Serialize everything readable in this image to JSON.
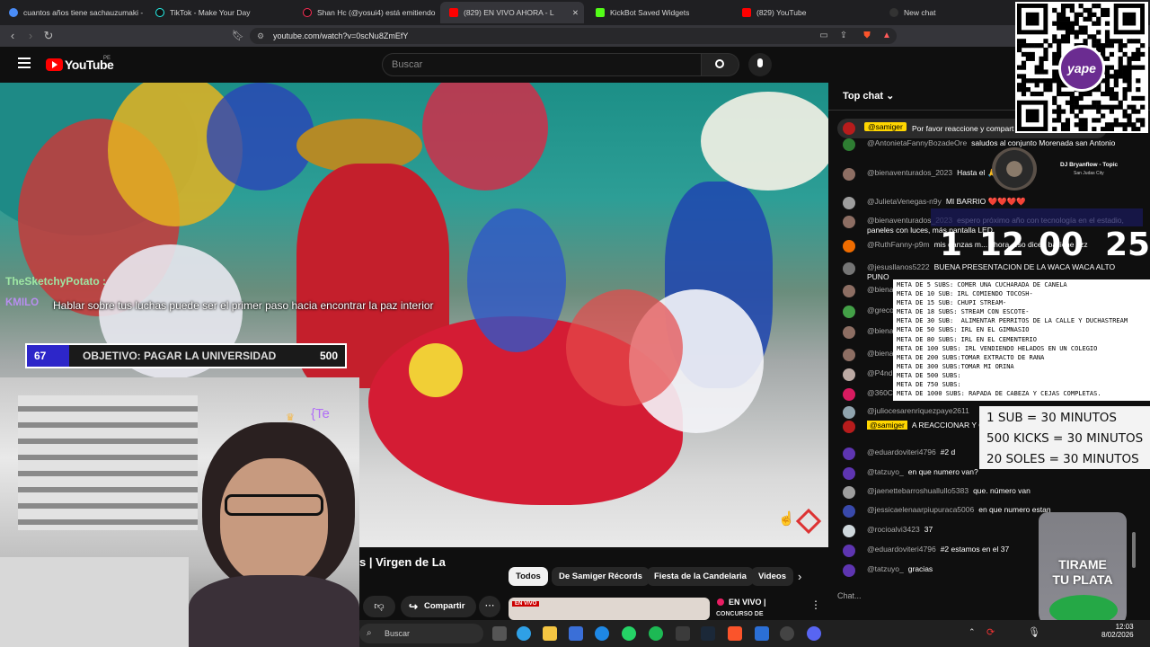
{
  "browser": {
    "tabs": [
      {
        "title": "cuantos años tiene sachauzumaki - B",
        "icon": "search-icon"
      },
      {
        "title": "TikTok - Make Your Day",
        "icon": "tiktok-icon"
      },
      {
        "title": "Shan Hc (@yosui4) está emitiendo L",
        "icon": "tiktok-icon"
      },
      {
        "title": "(829) EN VIVO AHORA - L",
        "icon": "youtube-icon"
      },
      {
        "title": "KickBot Saved Widgets",
        "icon": "kickbot-icon"
      },
      {
        "title": "(829) YouTube",
        "icon": "youtube-icon"
      },
      {
        "title": "New chat",
        "icon": "chat-icon"
      }
    ],
    "url": "youtube.com/watch?v=0scNu8ZmEfY"
  },
  "youtube": {
    "logo": "YouTube",
    "region": "PE",
    "search_placeholder": "Buscar"
  },
  "video": {
    "title_fragment": "s | Virgen de La",
    "filter_chips": [
      "Todos",
      "De Samiger Récords",
      "Fiesta de la Candelaria",
      "Videos"
    ],
    "share_label": "Compartir",
    "live_label": "EN VIVO |",
    "live_sub": "CONCURSO DE",
    "thumb_badge": "EN VIVO"
  },
  "overlay": {
    "chat_user": "TheSketchyPotato :",
    "chat_user2": "KMILO",
    "chat_message": "Hablar sobre tus luchas puede ser el primer paso hacia encontrar la paz interior",
    "goal_current": "67",
    "goal_text": "OBJETIVO: PAGAR LA UNIVERSIDAD",
    "goal_target": "500",
    "goal_fraction": 0.134,
    "cam_text": "{Te",
    "music_artist": "DJ Bryanflow - Topic",
    "music_sub": "San Judas City",
    "timer": [
      "1",
      "12",
      "00",
      "25"
    ],
    "goals_list": "META DE 5 SUBS: COMER UNA CUCHARADA DE CANELA\nMETA DE 10 SUB: IRL COMIENDO TOCOSH-\nMETA DE 15 SUB: CHUPI STREAM-\nMETA DE 18 SUBS: STREAM CON ESCOTE-\nMETA DE 30 SUB:  ALIMENTAR PERRITOS DE LA CALLE Y DUCHASTREAM\nMETA DE 50 SUBS: IRL EN EL GIMNASIO\nMETA DE 80 SUBS: IRL EN EL CEMENTERIO\nMETA DE 100 SUBS: IRL VENDIENDO HELADOS EN UN COLEGIO\nMETA DE 200 SUBS:TOMAR EXTRACTO DE RANA\nMETA DE 300 SUBS:TOMAR MI ORINA\nMETA DE 500 SUBS:\nMETA DE 750 SUBS:\nMETA DE 1000 SUBS: RAPADA DE CABEZA Y CEJAS COMPLETAS.",
    "kick_rates": "1 SUB = 30 MINUTOS\n500 KICKS = 30 MINUTOS\n20 SOLES = 30 MINUTOS",
    "jar_text": "TIRAME\nTU PLATA",
    "qr_label": "yape"
  },
  "chat": {
    "header": "Top chat",
    "pinned_user": "@samiger",
    "pinned_text": "Por favor reaccione y compart",
    "input_placeholder": "Chat...",
    "messages": [
      {
        "user": "@AntonietaFannyBozadeOre",
        "text": "saludos al conjunto Morenada san Antonio",
        "color": "#2e7d32"
      },
      {
        "user": "@bienaventurados_2023",
        "text": "Hasta el 🙏",
        "color": "#8d6e63"
      },
      {
        "user": "@JulietaVenegas-n9y",
        "text": "MI BARRIO ❤️❤️❤️❤️",
        "color": "#9e9e9e"
      },
      {
        "user": "@bienaventurados_2023",
        "text": "espero próximo año con tecnología en el estadio, paneles con luces, más pantalla LED",
        "color": "#8d6e63"
      },
      {
        "user": "@RuthFanny-p9m",
        "text": "mis danzas m... ahora, eso dicen bailiche zzz",
        "color": "#ef6c00"
      },
      {
        "user": "@jesusllanos5222",
        "text": "BUENA PRESENTACION DE LA WACA WACA ALTO PUNO",
        "color": "#757575"
      },
      {
        "user": "@biena",
        "text": "",
        "color": "#8d6e63"
      },
      {
        "user": "@greco",
        "text": "",
        "color": "#43a047"
      },
      {
        "user": "@biena",
        "text": "con mo",
        "color": "#8d6e63"
      },
      {
        "user": "@biena",
        "text": "",
        "color": "#8d6e63"
      },
      {
        "user": "@P4nd",
        "text": "",
        "color": "#bcaaa4"
      },
      {
        "user": "@360C",
        "text": "",
        "color": "#d81b60"
      },
      {
        "user": "@juliocesarenriquezpaye2611",
        "text": "",
        "color": "#90a4ae"
      },
      {
        "user": "@samiger",
        "text": "A REACCIONAR Y C... A ESTA TRANSMISION. GRACIAS",
        "color": "#b71c1c"
      },
      {
        "user": "@eduardoviteri4796",
        "text": "#2  d",
        "color": "#5e35b1"
      },
      {
        "user": "@tatzuyo_",
        "text": "en que numero van?",
        "color": "#5e35b1"
      },
      {
        "user": "@jaenettebarroshuallullo5383",
        "text": "que. número van",
        "color": "#9e9e9e"
      },
      {
        "user": "@jessicaelenaarpiupuraca5006",
        "text": "en que numero estan",
        "color": "#3949ab"
      },
      {
        "user": "@rocioalvi3423",
        "text": "37",
        "color": "#cfd8dc"
      },
      {
        "user": "@eduardoviteri4796",
        "text": "#2  estamos en el 37",
        "color": "#5e35b1"
      },
      {
        "user": "@tatzuyo_",
        "text": "gracias",
        "color": "#5e35b1"
      }
    ]
  },
  "taskbar": {
    "search_placeholder": "Buscar",
    "time": "12:03",
    "date": "8/02/2026"
  }
}
